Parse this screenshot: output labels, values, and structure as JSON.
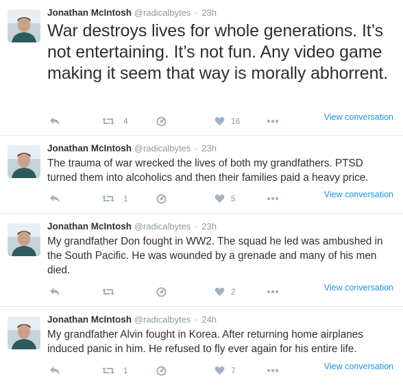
{
  "tweets": [
    {
      "fullname": "Jonathan McIntosh",
      "username": "@radicalbytes",
      "time": "23h",
      "text": "War destroys lives for whole generations. It’s not entertaining. It’s not fun. Any video game making it seem that way is morally abhorrent.",
      "retweets": "4",
      "likes": "16",
      "view_conversation": "View conversation"
    },
    {
      "fullname": "Jonathan McIntosh",
      "username": "@radicalbytes",
      "time": "23h",
      "text": "The trauma of war wrecked the lives of both my grandfathers. PTSD turned them into alcoholics and then their families paid a heavy price.",
      "retweets": "1",
      "likes": "5",
      "view_conversation": "View conversation"
    },
    {
      "fullname": "Jonathan McIntosh",
      "username": "@radicalbytes",
      "time": "23h",
      "text": "My grandfather Don fought in WW2. The squad he led was ambushed in the South Pacific. He was wounded by a grenade and many of his men died.",
      "retweets": "",
      "likes": "2",
      "view_conversation": "View conversation"
    },
    {
      "fullname": "Jonathan McIntosh",
      "username": "@radicalbytes",
      "time": "24h",
      "text": "My grandfather Alvin fought in Korea. After returning home airplanes induced panic in him. He refused to fly ever again for his entire life.",
      "retweets": "1",
      "likes": "7",
      "view_conversation": "View conversation"
    }
  ],
  "separator": "·",
  "colors": {
    "link": "#1b95e0",
    "meta": "#8899a6",
    "icon": "#a2b2bf",
    "text": "#292f33",
    "divider": "#e1e8ed"
  }
}
